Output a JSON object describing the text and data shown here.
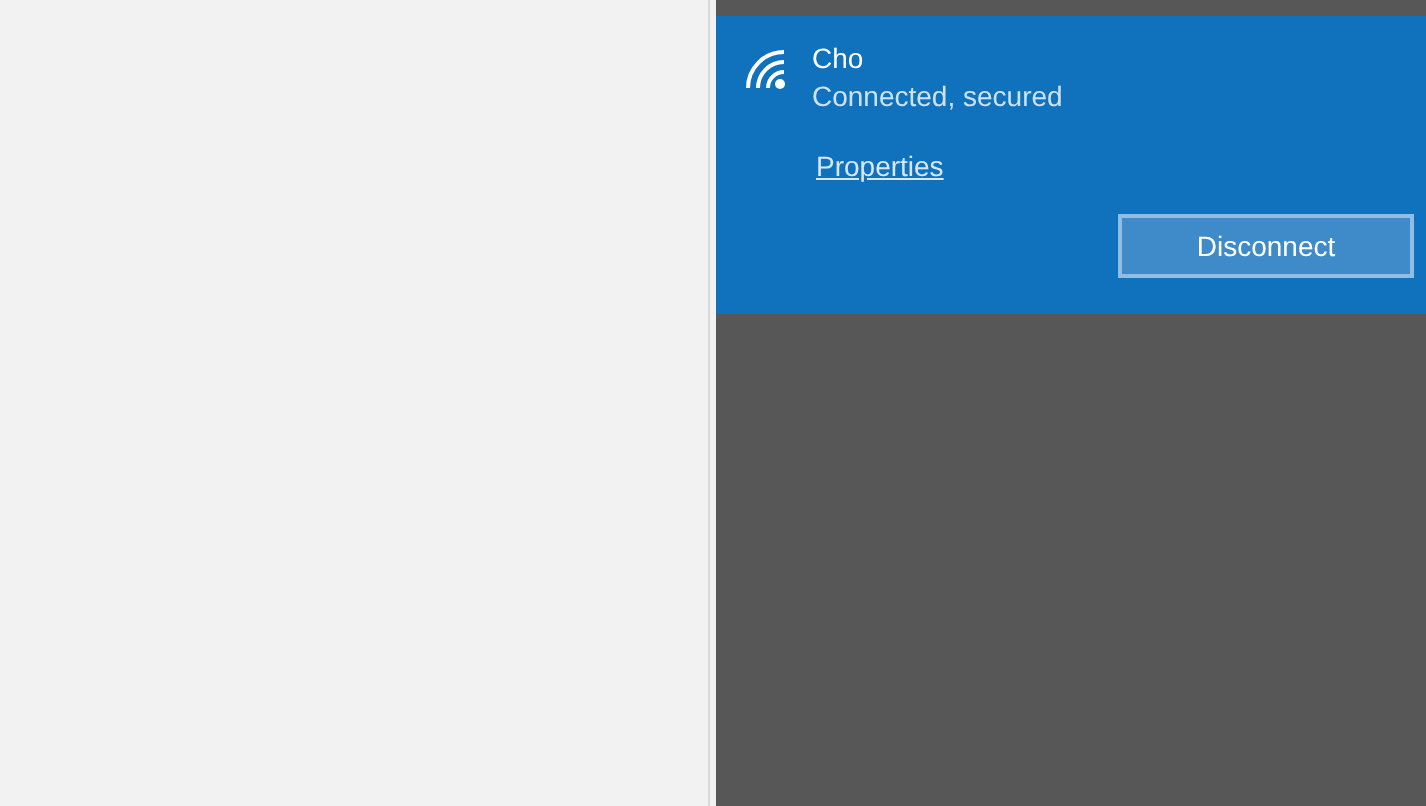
{
  "network": {
    "name": "Cho",
    "status": "Connected, secured",
    "properties_link": "Properties",
    "disconnect_button": "Disconnect"
  }
}
